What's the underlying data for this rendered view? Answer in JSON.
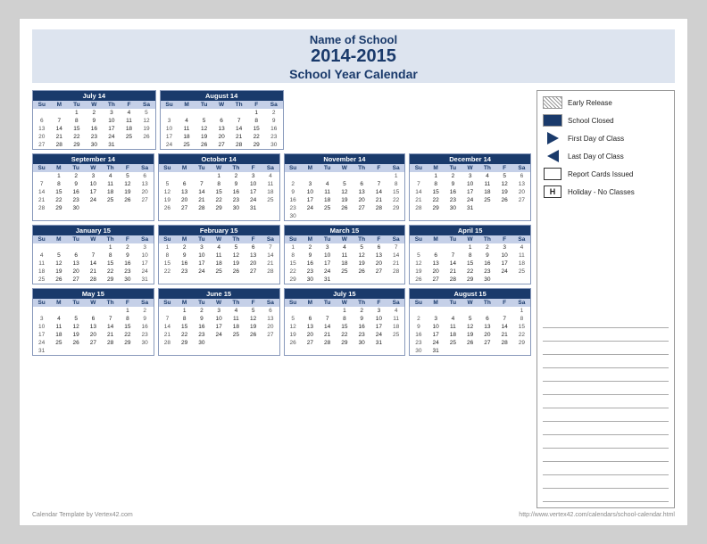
{
  "header": {
    "school_name": "Name of School",
    "year": "2014-2015",
    "cal_title": "School Year Calendar"
  },
  "legend": {
    "early_release": "Early Release",
    "school_closed": "School Closed",
    "first_day": "First Day of Class",
    "last_day": "Last Day of Class",
    "report_cards": "Report Cards Issued",
    "holiday": "Holiday - No Classes"
  },
  "footer": {
    "left": "Calendar Template by Vertex42.com",
    "right": "http://www.vertex42.com/calendars/school-calendar.html"
  },
  "months": [
    {
      "name": "July 14",
      "days_of_week": [
        "Su",
        "M",
        "Tu",
        "W",
        "Th",
        "F",
        "Sa"
      ],
      "weeks": [
        [
          "",
          "",
          "1",
          "2",
          "3",
          "4",
          "5"
        ],
        [
          "6",
          "7",
          "8",
          "9",
          "10",
          "11",
          "12"
        ],
        [
          "13",
          "14",
          "15",
          "16",
          "17",
          "18",
          "19"
        ],
        [
          "20",
          "21",
          "22",
          "23",
          "24",
          "25",
          "26"
        ],
        [
          "27",
          "28",
          "29",
          "30",
          "31",
          "",
          ""
        ]
      ]
    },
    {
      "name": "August 14",
      "days_of_week": [
        "Su",
        "M",
        "Tu",
        "W",
        "Th",
        "F",
        "Sa"
      ],
      "weeks": [
        [
          "",
          "",
          "",
          "",
          "",
          "1",
          "2"
        ],
        [
          "3",
          "4",
          "5",
          "6",
          "7",
          "8",
          "9"
        ],
        [
          "10",
          "11",
          "12",
          "13",
          "14",
          "15",
          "16"
        ],
        [
          "17",
          "18",
          "19",
          "20",
          "21",
          "22",
          "23"
        ],
        [
          "24",
          "25",
          "26",
          "27",
          "28",
          "29",
          "30"
        ]
      ]
    },
    {
      "name": "September 14",
      "days_of_week": [
        "Su",
        "M",
        "Tu",
        "W",
        "Th",
        "F",
        "Sa"
      ],
      "weeks": [
        [
          "",
          "1",
          "2",
          "3",
          "4",
          "5",
          "6"
        ],
        [
          "7",
          "8",
          "9",
          "10",
          "11",
          "12",
          "13"
        ],
        [
          "14",
          "15",
          "16",
          "17",
          "18",
          "19",
          "20"
        ],
        [
          "21",
          "22",
          "23",
          "24",
          "25",
          "26",
          "27"
        ],
        [
          "28",
          "29",
          "30",
          "",
          "",
          "",
          ""
        ]
      ]
    },
    {
      "name": "October 14",
      "days_of_week": [
        "Su",
        "M",
        "Tu",
        "W",
        "Th",
        "F",
        "Sa"
      ],
      "weeks": [
        [
          "",
          "",
          "",
          "1",
          "2",
          "3",
          "4"
        ],
        [
          "5",
          "6",
          "7",
          "8",
          "9",
          "10",
          "11"
        ],
        [
          "12",
          "13",
          "14",
          "15",
          "16",
          "17",
          "18"
        ],
        [
          "19",
          "20",
          "21",
          "22",
          "23",
          "24",
          "25"
        ],
        [
          "26",
          "27",
          "28",
          "29",
          "30",
          "31",
          ""
        ]
      ]
    },
    {
      "name": "November 14",
      "days_of_week": [
        "Su",
        "M",
        "Tu",
        "W",
        "Th",
        "F",
        "Sa"
      ],
      "weeks": [
        [
          "",
          "",
          "",
          "",
          "",
          "",
          "1"
        ],
        [
          "2",
          "3",
          "4",
          "5",
          "6",
          "7",
          "8"
        ],
        [
          "9",
          "10",
          "11",
          "12",
          "13",
          "14",
          "15"
        ],
        [
          "16",
          "17",
          "18",
          "19",
          "20",
          "21",
          "22"
        ],
        [
          "23",
          "24",
          "25",
          "26",
          "27",
          "28",
          "29"
        ],
        [
          "30",
          "",
          "",
          "",
          "",
          "",
          ""
        ]
      ]
    },
    {
      "name": "December 14",
      "days_of_week": [
        "Su",
        "M",
        "Tu",
        "W",
        "Th",
        "F",
        "Sa"
      ],
      "weeks": [
        [
          "",
          "1",
          "2",
          "3",
          "4",
          "5",
          "6"
        ],
        [
          "7",
          "8",
          "9",
          "10",
          "11",
          "12",
          "13"
        ],
        [
          "14",
          "15",
          "16",
          "17",
          "18",
          "19",
          "20"
        ],
        [
          "21",
          "22",
          "23",
          "24",
          "25",
          "26",
          "27"
        ],
        [
          "28",
          "29",
          "30",
          "31",
          "",
          "",
          ""
        ]
      ]
    },
    {
      "name": "January 15",
      "days_of_week": [
        "Su",
        "M",
        "Tu",
        "W",
        "Th",
        "F",
        "Sa"
      ],
      "weeks": [
        [
          "",
          "",
          "",
          "",
          "1",
          "2",
          "3"
        ],
        [
          "4",
          "5",
          "6",
          "7",
          "8",
          "9",
          "10"
        ],
        [
          "11",
          "12",
          "13",
          "14",
          "15",
          "16",
          "17"
        ],
        [
          "18",
          "19",
          "20",
          "21",
          "22",
          "23",
          "24"
        ],
        [
          "25",
          "26",
          "27",
          "28",
          "29",
          "30",
          "31"
        ]
      ]
    },
    {
      "name": "February 15",
      "days_of_week": [
        "Su",
        "M",
        "Tu",
        "W",
        "Th",
        "F",
        "Sa"
      ],
      "weeks": [
        [
          "1",
          "2",
          "3",
          "4",
          "5",
          "6",
          "7"
        ],
        [
          "8",
          "9",
          "10",
          "11",
          "12",
          "13",
          "14"
        ],
        [
          "15",
          "16",
          "17",
          "18",
          "19",
          "20",
          "21"
        ],
        [
          "22",
          "23",
          "24",
          "25",
          "26",
          "27",
          "28"
        ]
      ]
    },
    {
      "name": "March 15",
      "days_of_week": [
        "Su",
        "M",
        "Tu",
        "W",
        "Th",
        "F",
        "Sa"
      ],
      "weeks": [
        [
          "1",
          "2",
          "3",
          "4",
          "5",
          "6",
          "7"
        ],
        [
          "8",
          "9",
          "10",
          "11",
          "12",
          "13",
          "14"
        ],
        [
          "15",
          "16",
          "17",
          "18",
          "19",
          "20",
          "21"
        ],
        [
          "22",
          "23",
          "24",
          "25",
          "26",
          "27",
          "28"
        ],
        [
          "29",
          "30",
          "31",
          "",
          "",
          "",
          ""
        ]
      ]
    },
    {
      "name": "April 15",
      "days_of_week": [
        "Su",
        "M",
        "Tu",
        "W",
        "Th",
        "F",
        "Sa"
      ],
      "weeks": [
        [
          "",
          "",
          "",
          "1",
          "2",
          "3",
          "4"
        ],
        [
          "5",
          "6",
          "7",
          "8",
          "9",
          "10",
          "11"
        ],
        [
          "12",
          "13",
          "14",
          "15",
          "16",
          "17",
          "18"
        ],
        [
          "19",
          "20",
          "21",
          "22",
          "23",
          "24",
          "25"
        ],
        [
          "26",
          "27",
          "28",
          "29",
          "30",
          "",
          ""
        ]
      ]
    },
    {
      "name": "May 15",
      "days_of_week": [
        "Su",
        "M",
        "Tu",
        "W",
        "Th",
        "F",
        "Sa"
      ],
      "weeks": [
        [
          "",
          "",
          "",
          "",
          "",
          "1",
          "2"
        ],
        [
          "3",
          "4",
          "5",
          "6",
          "7",
          "8",
          "9"
        ],
        [
          "10",
          "11",
          "12",
          "13",
          "14",
          "15",
          "16"
        ],
        [
          "17",
          "18",
          "19",
          "20",
          "21",
          "22",
          "23"
        ],
        [
          "24",
          "25",
          "26",
          "27",
          "28",
          "29",
          "30"
        ],
        [
          "31",
          "",
          "",
          "",
          "",
          "",
          ""
        ]
      ]
    },
    {
      "name": "June 15",
      "days_of_week": [
        "Su",
        "M",
        "Tu",
        "W",
        "Th",
        "F",
        "Sa"
      ],
      "weeks": [
        [
          "",
          "1",
          "2",
          "3",
          "4",
          "5",
          "6"
        ],
        [
          "7",
          "8",
          "9",
          "10",
          "11",
          "12",
          "13"
        ],
        [
          "14",
          "15",
          "16",
          "17",
          "18",
          "19",
          "20"
        ],
        [
          "21",
          "22",
          "23",
          "24",
          "25",
          "26",
          "27"
        ],
        [
          "28",
          "29",
          "30",
          "",
          "",
          "",
          ""
        ]
      ]
    },
    {
      "name": "July 15",
      "days_of_week": [
        "Su",
        "M",
        "Tu",
        "W",
        "Th",
        "F",
        "Sa"
      ],
      "weeks": [
        [
          "",
          "",
          "",
          "1",
          "2",
          "3",
          "4"
        ],
        [
          "5",
          "6",
          "7",
          "8",
          "9",
          "10",
          "11"
        ],
        [
          "12",
          "13",
          "14",
          "15",
          "16",
          "17",
          "18"
        ],
        [
          "19",
          "20",
          "21",
          "22",
          "23",
          "24",
          "25"
        ],
        [
          "26",
          "27",
          "28",
          "29",
          "30",
          "31",
          ""
        ]
      ]
    },
    {
      "name": "August 15",
      "days_of_week": [
        "Su",
        "M",
        "Tu",
        "W",
        "Th",
        "F",
        "Sa"
      ],
      "weeks": [
        [
          "",
          "",
          "",
          "",
          "",
          "",
          "1"
        ],
        [
          "2",
          "3",
          "4",
          "5",
          "6",
          "7",
          "8"
        ],
        [
          "9",
          "10",
          "11",
          "12",
          "13",
          "14",
          "15"
        ],
        [
          "16",
          "17",
          "18",
          "19",
          "20",
          "21",
          "22"
        ],
        [
          "23",
          "24",
          "25",
          "26",
          "27",
          "28",
          "29"
        ],
        [
          "30",
          "31",
          "",
          "",
          "",
          "",
          ""
        ]
      ]
    }
  ]
}
